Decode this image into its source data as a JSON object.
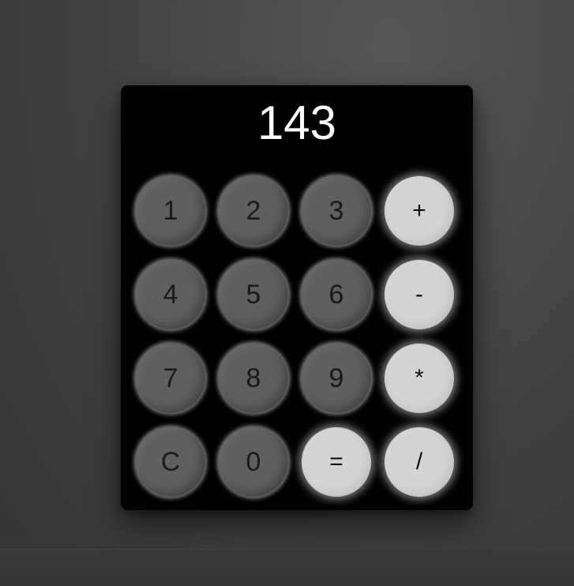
{
  "display": {
    "value": "143"
  },
  "keys": {
    "k1": "1",
    "k2": "2",
    "k3": "3",
    "plus": "+",
    "k4": "4",
    "k5": "5",
    "k6": "6",
    "minus": "-",
    "k7": "7",
    "k8": "8",
    "k9": "9",
    "multiply": "*",
    "clear": "C",
    "k0": "0",
    "equals": "=",
    "divide": "/"
  },
  "colors": {
    "background": "#454545",
    "calculator_body": "#000000",
    "number_key": "#5f5f5f",
    "operator_key": "#d4d4d4",
    "display_text": "#ffffff"
  }
}
